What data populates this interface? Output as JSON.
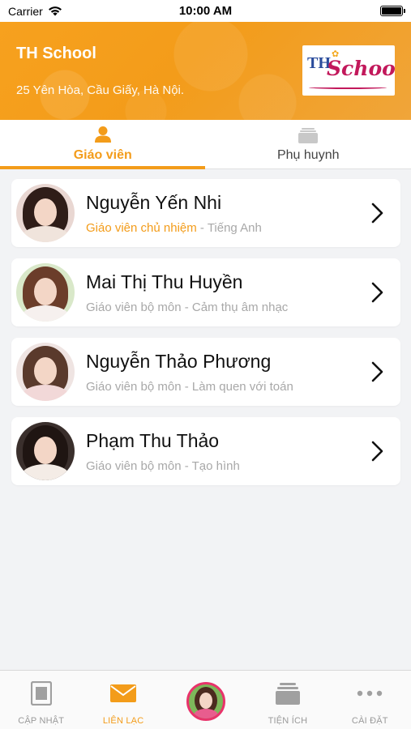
{
  "status_bar": {
    "carrier": "Carrier",
    "time": "10:00 AM"
  },
  "header": {
    "school_name": "TH School",
    "address": "25 Yên Hòa, Cầu Giấy, Hà Nội.",
    "logo_text_th": "TH",
    "logo_text_school": "School"
  },
  "tabs": [
    {
      "label": "Giáo viên",
      "icon": "person-icon",
      "active": true
    },
    {
      "label": "Phụ huynh",
      "icon": "card-stack-icon",
      "active": false
    }
  ],
  "teachers": [
    {
      "name": "Nguyễn Yến Nhi",
      "role": "Giáo viên chủ nhiệm",
      "separator": " - ",
      "subject": "Tiếng Anh",
      "role_highlight": true
    },
    {
      "name": "Mai Thị Thu Huyền",
      "role": "Giáo viên bộ môn",
      "separator": " - ",
      "subject": "Cảm thụ âm nhạc",
      "role_highlight": false
    },
    {
      "name": "Nguyễn Thảo Phương",
      "role": "Giáo viên bộ môn",
      "separator": " - ",
      "subject": "Làm quen với toán",
      "role_highlight": false
    },
    {
      "name": "Phạm Thu Thảo",
      "role": "Giáo viên bộ môn",
      "separator": " - ",
      "subject": "Tạo hình",
      "role_highlight": false
    }
  ],
  "bottom_nav": [
    {
      "label": "CẬP NHẬT",
      "icon": "news-icon",
      "active": false
    },
    {
      "label": "LIÊN LẠC",
      "icon": "envelope-icon",
      "active": true
    },
    {
      "label": "",
      "icon": "profile-avatar",
      "active": false
    },
    {
      "label": "TIỆN ÍCH",
      "icon": "card-stack-icon",
      "active": false
    },
    {
      "label": "CÀI ĐẶT",
      "icon": "more-dots-icon",
      "active": false
    }
  ],
  "colors": {
    "accent": "#f39c1a",
    "header_bg": "#f7a11e",
    "muted_text": "#a8a8a8",
    "avatar_ring": "#e8336b"
  }
}
